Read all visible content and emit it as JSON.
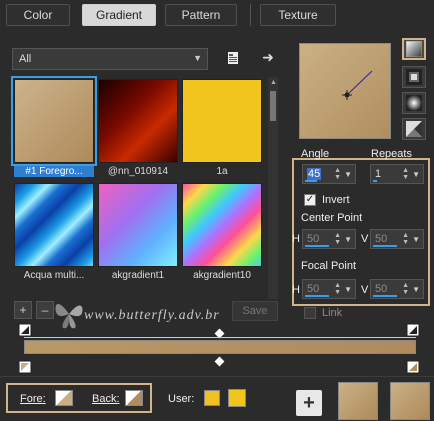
{
  "tabs": [
    "Color",
    "Gradient",
    "Pattern",
    "Texture"
  ],
  "active_tab": "Gradient",
  "filter_dropdown": {
    "value": "All"
  },
  "gradients": [
    {
      "label": "#1 Foregro...",
      "selected": true
    },
    {
      "label": "@nn_010914",
      "selected": false
    },
    {
      "label": "1a",
      "selected": false
    },
    {
      "label": "Acqua multi...",
      "selected": false
    },
    {
      "label": "akgradient1",
      "selected": false
    },
    {
      "label": "akgradient10",
      "selected": false
    }
  ],
  "angle": {
    "label": "Angle",
    "value": "45"
  },
  "repeats": {
    "label": "Repeats",
    "value": "1"
  },
  "invert": {
    "label": "Invert",
    "checked": true
  },
  "center_point": {
    "label": "Center Point",
    "h_label": "H",
    "h_value": "50",
    "v_label": "V",
    "v_value": "50"
  },
  "focal_point": {
    "label": "Focal Point",
    "h_label": "H",
    "h_value": "50",
    "v_label": "V",
    "v_value": "50"
  },
  "link": {
    "label": "Link"
  },
  "save_label": "Save",
  "watermark_text": "www.butterfly.adv.br",
  "fore_label": "Fore:",
  "back_label": "Back:",
  "user_label": "User:",
  "colors": {
    "accent": "#d2b48c",
    "selection": "#3b9de6",
    "user1": "#f0c020",
    "user2": "#f2c51e",
    "fore": "#c8ae80",
    "back": "#b08c5e"
  }
}
